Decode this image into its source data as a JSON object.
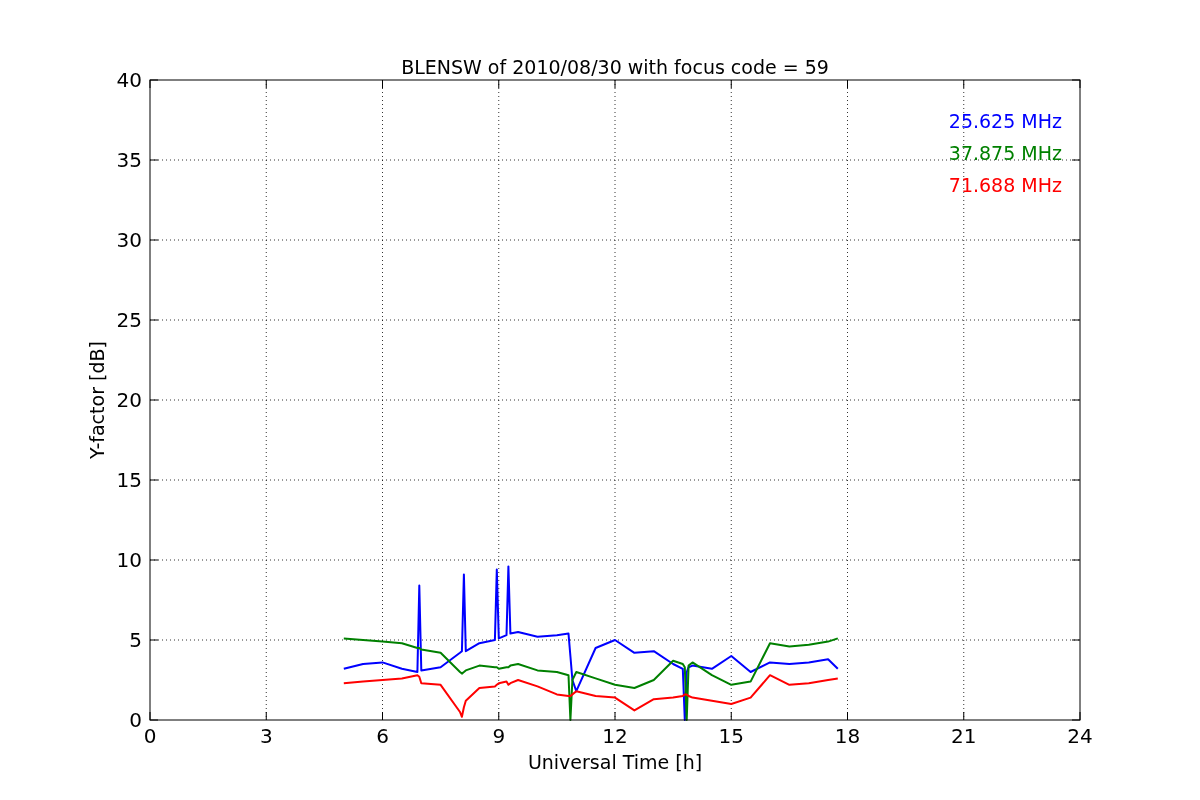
{
  "chart_data": {
    "type": "line",
    "title": "BLENSW of 2010/08/30 with focus code = 59",
    "xlabel": "Universal Time [h]",
    "ylabel": "Y-factor [dB]",
    "xlim": [
      0,
      24
    ],
    "ylim": [
      0,
      40
    ],
    "xticks": [
      0,
      3,
      6,
      9,
      12,
      15,
      18,
      21,
      24
    ],
    "yticks": [
      0,
      5,
      10,
      15,
      20,
      25,
      30,
      35,
      40
    ],
    "grid": true,
    "x": [
      5,
      5.5,
      6,
      6.5,
      6.9,
      6.95,
      7,
      7.5,
      8,
      8.05,
      8.1,
      8.15,
      8.5,
      8.9,
      8.95,
      9,
      9.2,
      9.25,
      9.3,
      9.5,
      10,
      10.5,
      10.8,
      10.85,
      10.9,
      11,
      11.5,
      12,
      12.5,
      13,
      13.5,
      13.75,
      13.8,
      13.85,
      13.9,
      14,
      14.5,
      15,
      15.5,
      16,
      16.5,
      17,
      17.5,
      17.75
    ],
    "series": [
      {
        "name": "25.625 MHz",
        "color": "#0000ff",
        "values": [
          3.2,
          3.5,
          3.6,
          3.2,
          3.0,
          8.4,
          3.1,
          3.3,
          4.2,
          4.3,
          9.1,
          4.3,
          4.8,
          5.0,
          9.4,
          5.1,
          5.3,
          9.6,
          5.4,
          5.5,
          5.2,
          5.3,
          5.4,
          4.0,
          2.5,
          1.8,
          4.5,
          5.0,
          4.2,
          4.3,
          3.5,
          3.2,
          0,
          3.0,
          3.3,
          3.4,
          3.2,
          4.0,
          3.0,
          3.6,
          3.5,
          3.6,
          3.8,
          3.2
        ]
      },
      {
        "name": "37.875 MHz",
        "color": "#008000",
        "values": [
          5.1,
          5.0,
          4.9,
          4.8,
          4.5,
          4.5,
          4.4,
          4.2,
          3.0,
          2.9,
          3.0,
          3.1,
          3.4,
          3.3,
          3.3,
          3.2,
          3.3,
          3.3,
          3.4,
          3.5,
          3.1,
          3.0,
          2.8,
          0,
          2.5,
          3.0,
          2.6,
          2.2,
          2.0,
          2.5,
          3.7,
          3.5,
          3.3,
          0,
          3.4,
          3.6,
          2.8,
          2.2,
          2.4,
          4.8,
          4.6,
          4.7,
          4.9,
          5.1
        ]
      },
      {
        "name": "71.688 MHz",
        "color": "#ff0000",
        "values": [
          2.3,
          2.4,
          2.5,
          2.6,
          2.8,
          2.7,
          2.3,
          2.2,
          0.5,
          0.2,
          0.8,
          1.2,
          2.0,
          2.1,
          2.2,
          2.3,
          2.4,
          2.2,
          2.3,
          2.5,
          2.1,
          1.6,
          1.5,
          1.5,
          1.6,
          1.8,
          1.5,
          1.4,
          0.6,
          1.3,
          1.4,
          1.5,
          1.6,
          1.6,
          1.5,
          1.4,
          1.2,
          1.0,
          1.4,
          2.8,
          2.2,
          2.3,
          2.5,
          2.6
        ]
      }
    ]
  }
}
